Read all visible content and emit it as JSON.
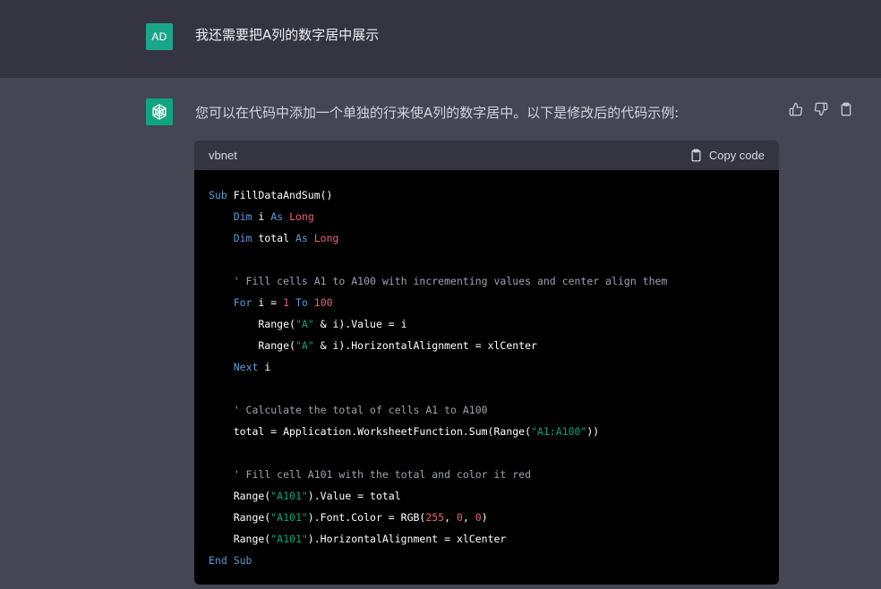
{
  "user": {
    "avatar_initials": "AD",
    "avatar_color": "#1aa68a",
    "message": "我还需要把A列的数字居中展示"
  },
  "assistant": {
    "avatar_color": "#10a37f",
    "intro": "您可以在代码中添加一个单独的行来使A列的数字居中。以下是修改后的代码示例:",
    "actions": [
      "thumbs-up-icon",
      "thumbs-down-icon",
      "clipboard-icon"
    ],
    "code_block": {
      "language": "vbnet",
      "copy_label": "Copy code",
      "lines": [
        "Sub FillDataAndSum()",
        "    Dim i As Long",
        "    Dim total As Long",
        "",
        "    ' Fill cells A1 to A100 with incrementing values and center align them",
        "    For i = 1 To 100",
        "        Range(\"A\" & i).Value = i",
        "        Range(\"A\" & i).HorizontalAlignment = xlCenter",
        "    Next i",
        "",
        "    ' Calculate the total of cells A1 to A100",
        "    total = Application.WorksheetFunction.Sum(Range(\"A1:A100\"))",
        "",
        "    ' Fill cell A101 with the total and color it red",
        "    Range(\"A101\").Value = total",
        "    Range(\"A101\").Font.Color = RGB(255, 0, 0)",
        "    Range(\"A101\").HorizontalAlignment = xlCenter",
        "End Sub"
      ]
    }
  },
  "colors": {
    "user_bg": "#343541",
    "assistant_bg": "#444654",
    "code_bg": "#000000",
    "keyword": "#5b9bd5",
    "number": "#e9627a",
    "string": "#00a67d",
    "comment": "#9ca3af"
  }
}
